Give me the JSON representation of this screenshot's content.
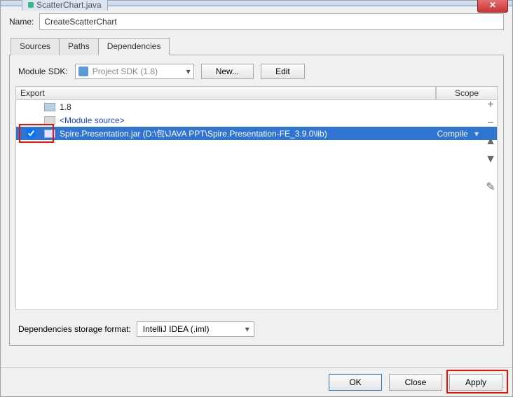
{
  "window": {
    "close_glyph": "✕",
    "background_tab": "ScatterChart.java"
  },
  "name_field": {
    "label": "Name:",
    "value": "CreateScatterChart"
  },
  "tabs": {
    "sources": "Sources",
    "paths": "Paths",
    "dependencies": "Dependencies"
  },
  "sdk": {
    "label": "Module SDK:",
    "combo_text": "Project SDK (1.8)",
    "new_btn": "New...",
    "edit_btn": "Edit"
  },
  "columns": {
    "export": "Export",
    "scope": "Scope"
  },
  "rows": {
    "jdk": "1.8",
    "module_source": "<Module source>",
    "jar": "Spire.Presentation.jar (D:\\包\\JAVA PPT\\Spire.Presentation-FE_3.9.0\\lib)",
    "jar_scope": "Compile"
  },
  "side_icons": {
    "add": "+",
    "remove": "−",
    "up": "▲",
    "down": "▼",
    "edit": "✎"
  },
  "storage": {
    "label": "Dependencies storage format:",
    "value": "IntelliJ IDEA (.iml)"
  },
  "footer": {
    "ok": "OK",
    "close": "Close",
    "apply": "Apply"
  }
}
